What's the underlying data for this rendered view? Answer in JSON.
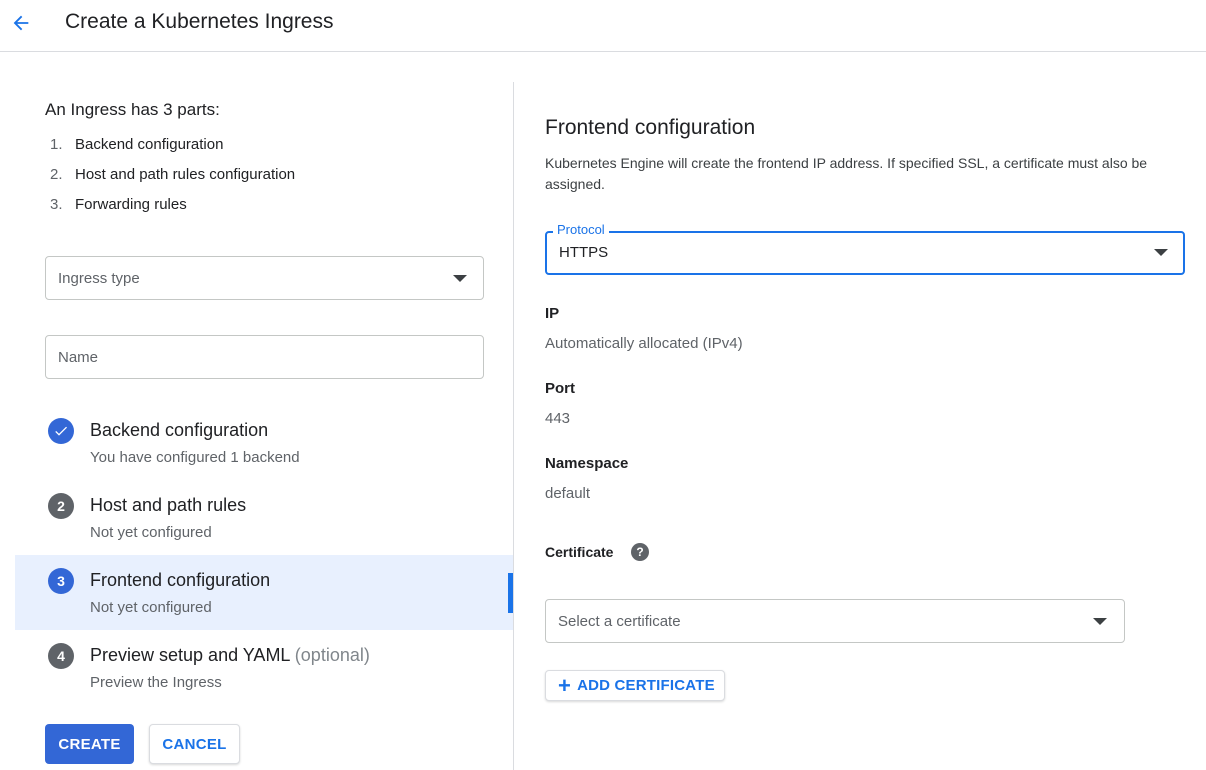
{
  "header": {
    "title": "Create a Kubernetes Ingress"
  },
  "intro": {
    "heading": "An Ingress has 3 parts:",
    "parts": [
      {
        "num": "1.",
        "label": "Backend configuration"
      },
      {
        "num": "2.",
        "label": "Host and path rules configuration"
      },
      {
        "num": "3.",
        "label": "Forwarding rules"
      }
    ]
  },
  "form": {
    "ingress_type_placeholder": "Ingress type",
    "name_placeholder": "Name"
  },
  "steps": [
    {
      "marker": "✓",
      "title": "Backend configuration",
      "subtitle": "You have configured 1 backend",
      "status": "complete"
    },
    {
      "marker": "2",
      "title": "Host and path rules",
      "subtitle": "Not yet configured",
      "status": "pending"
    },
    {
      "marker": "3",
      "title": "Frontend configuration",
      "subtitle": "Not yet configured",
      "status": "active"
    },
    {
      "marker": "4",
      "title": "Preview setup and YAML",
      "optional": "(optional)",
      "subtitle": "Preview the Ingress",
      "status": "pending"
    }
  ],
  "actions": {
    "create": "CREATE",
    "cancel": "CANCEL"
  },
  "frontend": {
    "title": "Frontend configuration",
    "description": "Kubernetes Engine will create the frontend IP address. If specified SSL, a certificate must also be assigned.",
    "protocol": {
      "label": "Protocol",
      "value": "HTTPS"
    },
    "ip": {
      "label": "IP",
      "value": "Automatically allocated (IPv4)"
    },
    "port": {
      "label": "Port",
      "value": "443"
    },
    "namespace": {
      "label": "Namespace",
      "value": "default"
    },
    "certificate": {
      "label": "Certificate",
      "help_icon": "?",
      "placeholder": "Select a certificate",
      "add_button": "ADD CERTIFICATE"
    }
  },
  "colors": {
    "accent": "#1a73e8",
    "primary_button": "#3367d6",
    "active_step_bg": "#e8f0fe",
    "pending_step_marker": "#5f6368"
  }
}
